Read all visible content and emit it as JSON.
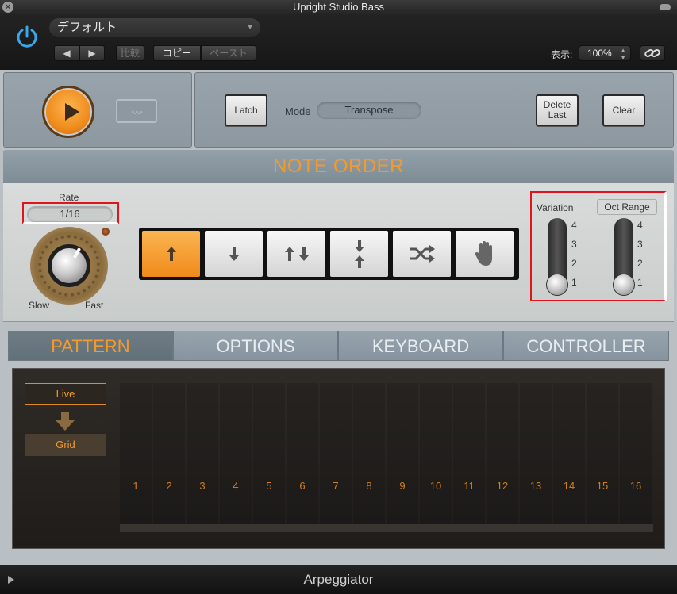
{
  "window": {
    "title": "Upright Studio Bass"
  },
  "header": {
    "preset": "デフォルト",
    "prev": "◀",
    "next": "▶",
    "compare": "比較",
    "copy": "コピー",
    "paste": "ペースト",
    "display_label": "表示:",
    "zoom": "100%"
  },
  "transport": {
    "pattern_icon": "-.-.-"
  },
  "controls": {
    "latch": "Latch",
    "mode_label": "Mode",
    "mode_value": "Transpose",
    "delete_last": "Delete Last",
    "clear": "Clear"
  },
  "note_order": {
    "title": "NOTE ORDER",
    "rate_label": "Rate",
    "rate_value": "1/16",
    "slow": "Slow",
    "fast": "Fast",
    "knob_level": 0.6,
    "orders": [
      "up",
      "down",
      "up-down",
      "outside-in",
      "random",
      "as-played"
    ],
    "active_order": "up",
    "variation_label": "Variation",
    "oct_range_label": "Oct Range",
    "scale": [
      "4",
      "3",
      "2",
      "1"
    ],
    "variation_value": 1,
    "oct_range_value": 1
  },
  "tabs": [
    {
      "label": "PATTERN",
      "active": true
    },
    {
      "label": "OPTIONS",
      "active": false
    },
    {
      "label": "KEYBOARD",
      "active": false
    },
    {
      "label": "CONTROLLER",
      "active": false
    }
  ],
  "pattern": {
    "live": "Live",
    "grid": "Grid",
    "steps": [
      "1",
      "2",
      "3",
      "4",
      "5",
      "6",
      "7",
      "8",
      "9",
      "10",
      "11",
      "12",
      "13",
      "14",
      "15",
      "16"
    ]
  },
  "footer": {
    "title": "Arpeggiator"
  },
  "colors": {
    "accent": "#f49a2b",
    "highlight": "#e0141c"
  }
}
